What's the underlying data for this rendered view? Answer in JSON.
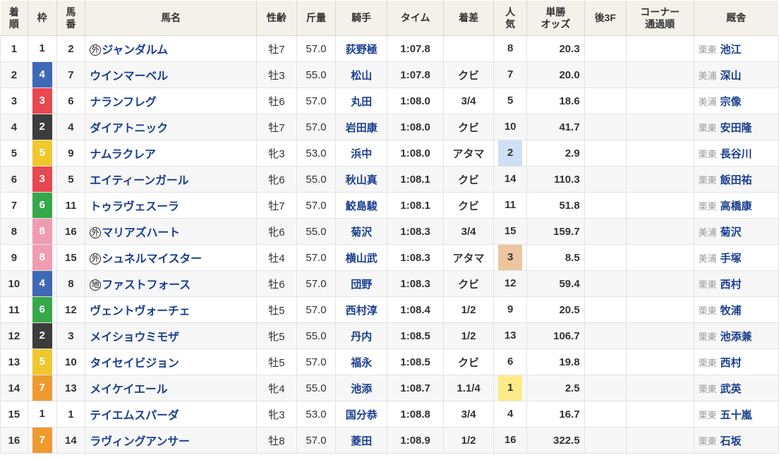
{
  "table": {
    "headers": {
      "rank": "着順",
      "frame": "枠",
      "horse_no": "馬番",
      "horse_name": "馬名",
      "sex_age": "性齢",
      "weight": "斤量",
      "jockey": "騎手",
      "time": "タイム",
      "margin": "着差",
      "popularity": "人気",
      "odds": "単勝\nオッズ",
      "odds_line1": "単勝",
      "odds_line2": "オッズ",
      "last_3f": "後3F",
      "corner": "コーナー\n通過順",
      "corner_line1": "コーナー",
      "corner_line2": "通過順",
      "stable": "厩舎",
      "rank_line1": "着",
      "rank_line2": "順"
    },
    "frame_colors": {
      "1": "#ffffff",
      "2": "#3c3c3c",
      "3": "#e8484f",
      "4": "#4069b5",
      "5": "#efc72f",
      "6": "#35a94a",
      "7": "#ee9a30",
      "8": "#f09cb0"
    },
    "popularity_colors": {
      "1": "#fdeb87",
      "2": "#cfdff5",
      "3": "#edc6a0"
    },
    "rows": [
      {
        "rank": "1",
        "frame": "1",
        "horse_no": "2",
        "mark": "外",
        "horse_name": "ジャンダルム",
        "sex_age": "牡7",
        "weight": "57.0",
        "jockey": "荻野極",
        "time": "1:07.8",
        "margin": "",
        "popularity": "8",
        "odds": "20.3",
        "last_3f": "",
        "corner": "",
        "stable_area": "栗東",
        "stable_name": "池江"
      },
      {
        "rank": "2",
        "frame": "4",
        "horse_no": "7",
        "mark": "",
        "horse_name": "ウインマーベル",
        "sex_age": "牡3",
        "weight": "55.0",
        "jockey": "松山",
        "time": "1:07.8",
        "margin": "クビ",
        "popularity": "7",
        "odds": "20.0",
        "last_3f": "",
        "corner": "",
        "stable_area": "美浦",
        "stable_name": "深山"
      },
      {
        "rank": "3",
        "frame": "3",
        "horse_no": "6",
        "mark": "",
        "horse_name": "ナランフレグ",
        "sex_age": "牡6",
        "weight": "57.0",
        "jockey": "丸田",
        "time": "1:08.0",
        "margin": "3/4",
        "popularity": "5",
        "odds": "18.6",
        "last_3f": "",
        "corner": "",
        "stable_area": "美浦",
        "stable_name": "宗像"
      },
      {
        "rank": "4",
        "frame": "2",
        "horse_no": "4",
        "mark": "",
        "horse_name": "ダイアトニック",
        "sex_age": "牡7",
        "weight": "57.0",
        "jockey": "岩田康",
        "time": "1:08.0",
        "margin": "クビ",
        "popularity": "10",
        "odds": "41.7",
        "last_3f": "",
        "corner": "",
        "stable_area": "栗東",
        "stable_name": "安田隆"
      },
      {
        "rank": "5",
        "frame": "5",
        "horse_no": "9",
        "mark": "",
        "horse_name": "ナムラクレア",
        "sex_age": "牝3",
        "weight": "53.0",
        "jockey": "浜中",
        "time": "1:08.0",
        "margin": "アタマ",
        "popularity": "2",
        "odds": "2.9",
        "last_3f": "",
        "corner": "",
        "stable_area": "栗東",
        "stable_name": "長谷川"
      },
      {
        "rank": "6",
        "frame": "3",
        "horse_no": "5",
        "mark": "",
        "horse_name": "エイティーンガール",
        "sex_age": "牝6",
        "weight": "55.0",
        "jockey": "秋山真",
        "time": "1:08.1",
        "margin": "クビ",
        "popularity": "14",
        "odds": "110.3",
        "last_3f": "",
        "corner": "",
        "stable_area": "栗東",
        "stable_name": "飯田祐"
      },
      {
        "rank": "7",
        "frame": "6",
        "horse_no": "11",
        "mark": "",
        "horse_name": "トゥラヴェスーラ",
        "sex_age": "牡7",
        "weight": "57.0",
        "jockey": "鮫島駿",
        "time": "1:08.1",
        "margin": "クビ",
        "popularity": "11",
        "odds": "51.8",
        "last_3f": "",
        "corner": "",
        "stable_area": "栗東",
        "stable_name": "高橋康"
      },
      {
        "rank": "8",
        "frame": "8",
        "horse_no": "16",
        "mark": "外",
        "horse_name": "マリアズハート",
        "sex_age": "牝6",
        "weight": "55.0",
        "jockey": "菊沢",
        "time": "1:08.3",
        "margin": "3/4",
        "popularity": "15",
        "odds": "159.7",
        "last_3f": "",
        "corner": "",
        "stable_area": "美浦",
        "stable_name": "菊沢"
      },
      {
        "rank": "9",
        "frame": "8",
        "horse_no": "15",
        "mark": "外",
        "horse_name": "シュネルマイスター",
        "sex_age": "牡4",
        "weight": "57.0",
        "jockey": "横山武",
        "time": "1:08.3",
        "margin": "アタマ",
        "popularity": "3",
        "odds": "8.5",
        "last_3f": "",
        "corner": "",
        "stable_area": "美浦",
        "stable_name": "手塚"
      },
      {
        "rank": "10",
        "frame": "4",
        "horse_no": "8",
        "mark": "地",
        "horse_name": "ファストフォース",
        "sex_age": "牡6",
        "weight": "57.0",
        "jockey": "団野",
        "time": "1:08.3",
        "margin": "クビ",
        "popularity": "12",
        "odds": "59.4",
        "last_3f": "",
        "corner": "",
        "stable_area": "栗東",
        "stable_name": "西村"
      },
      {
        "rank": "11",
        "frame": "6",
        "horse_no": "12",
        "mark": "",
        "horse_name": "ヴェントヴォーチェ",
        "sex_age": "牡5",
        "weight": "57.0",
        "jockey": "西村淳",
        "time": "1:08.4",
        "margin": "1/2",
        "popularity": "9",
        "odds": "20.5",
        "last_3f": "",
        "corner": "",
        "stable_area": "栗東",
        "stable_name": "牧浦"
      },
      {
        "rank": "12",
        "frame": "2",
        "horse_no": "3",
        "mark": "",
        "horse_name": "メイショウミモザ",
        "sex_age": "牝5",
        "weight": "55.0",
        "jockey": "丹内",
        "time": "1:08.5",
        "margin": "1/2",
        "popularity": "13",
        "odds": "106.7",
        "last_3f": "",
        "corner": "",
        "stable_area": "栗東",
        "stable_name": "池添兼"
      },
      {
        "rank": "13",
        "frame": "5",
        "horse_no": "10",
        "mark": "",
        "horse_name": "タイセイビジョン",
        "sex_age": "牡5",
        "weight": "57.0",
        "jockey": "福永",
        "time": "1:08.5",
        "margin": "クビ",
        "popularity": "6",
        "odds": "19.8",
        "last_3f": "",
        "corner": "",
        "stable_area": "栗東",
        "stable_name": "西村"
      },
      {
        "rank": "14",
        "frame": "7",
        "horse_no": "13",
        "mark": "",
        "horse_name": "メイケイエール",
        "sex_age": "牝4",
        "weight": "55.0",
        "jockey": "池添",
        "time": "1:08.7",
        "margin": "1.1/4",
        "popularity": "1",
        "odds": "2.5",
        "last_3f": "",
        "corner": "",
        "stable_area": "栗東",
        "stable_name": "武英"
      },
      {
        "rank": "15",
        "frame": "1",
        "horse_no": "1",
        "mark": "",
        "horse_name": "テイエムスパーダ",
        "sex_age": "牝3",
        "weight": "53.0",
        "jockey": "国分恭",
        "time": "1:08.8",
        "margin": "3/4",
        "popularity": "4",
        "odds": "16.7",
        "last_3f": "",
        "corner": "",
        "stable_area": "栗東",
        "stable_name": "五十嵐"
      },
      {
        "rank": "16",
        "frame": "7",
        "horse_no": "14",
        "mark": "",
        "horse_name": "ラヴィングアンサー",
        "sex_age": "牡8",
        "weight": "57.0",
        "jockey": "菱田",
        "time": "1:08.9",
        "margin": "1/2",
        "popularity": "16",
        "odds": "322.5",
        "last_3f": "",
        "corner": "",
        "stable_area": "栗東",
        "stable_name": "石坂"
      }
    ]
  }
}
